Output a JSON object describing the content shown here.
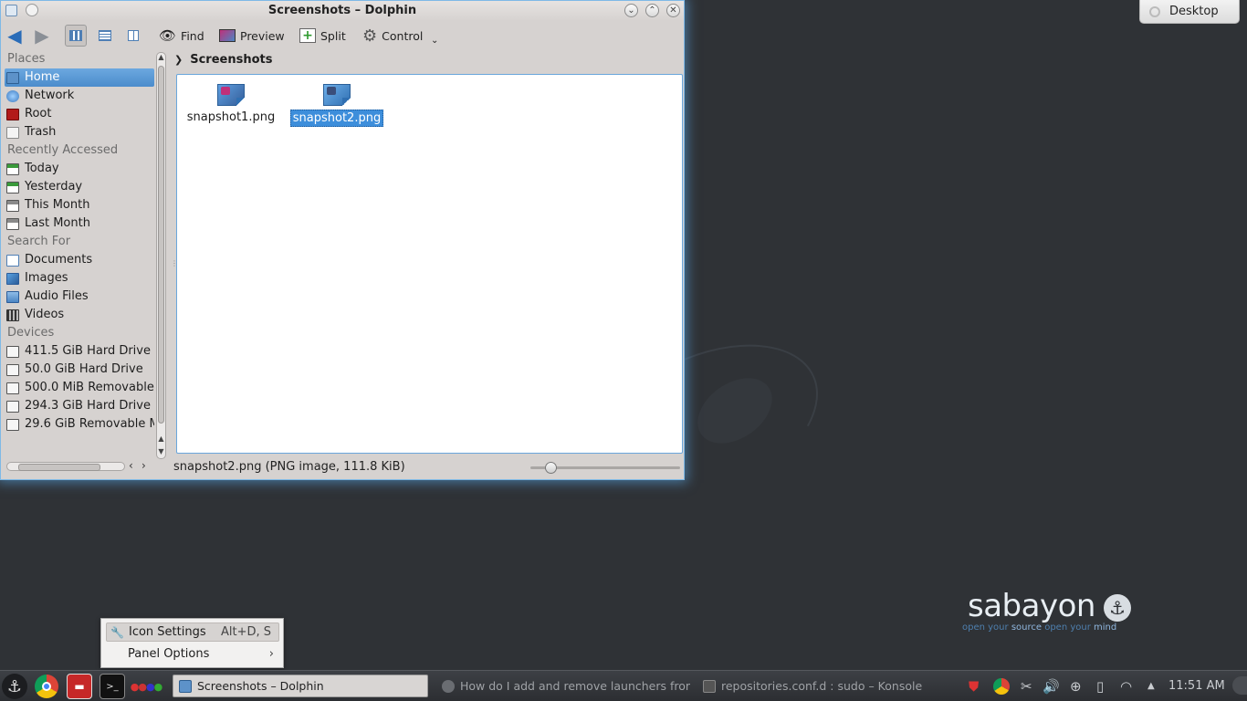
{
  "window": {
    "title": "Screenshots – Dolphin",
    "controls": {
      "minimize": "⌄",
      "maximize": "⌃",
      "close": "✕"
    }
  },
  "toolbar": {
    "back_icon": "go-previous-icon",
    "forward_icon": "go-next-icon",
    "find_label": "Find",
    "preview_label": "Preview",
    "split_label": "Split",
    "control_label": "Control",
    "more_icon": "chevron-down-icon"
  },
  "places": {
    "sections": [
      {
        "label": "Places",
        "items": [
          {
            "label": "Home",
            "icon": "home-folder-icon",
            "selected": true
          },
          {
            "label": "Network",
            "icon": "network-icon"
          },
          {
            "label": "Root",
            "icon": "root-folder-icon"
          },
          {
            "label": "Trash",
            "icon": "trash-icon"
          }
        ]
      },
      {
        "label": "Recently Accessed",
        "items": [
          {
            "label": "Today",
            "icon": "calendar-today-icon"
          },
          {
            "label": "Yesterday",
            "icon": "calendar-yesterday-icon"
          },
          {
            "label": "This Month",
            "icon": "calendar-month-icon"
          },
          {
            "label": "Last Month",
            "icon": "calendar-last-month-icon"
          }
        ]
      },
      {
        "label": "Search For",
        "items": [
          {
            "label": "Documents",
            "icon": "documents-icon"
          },
          {
            "label": "Images",
            "icon": "images-icon"
          },
          {
            "label": "Audio Files",
            "icon": "audio-icon"
          },
          {
            "label": "Videos",
            "icon": "videos-icon"
          }
        ]
      },
      {
        "label": "Devices",
        "items": [
          {
            "label": "411.5 GiB Hard Drive",
            "icon": "hard-drive-icon"
          },
          {
            "label": "50.0 GiB Hard Drive",
            "icon": "hard-drive-icon"
          },
          {
            "label": "500.0 MiB Removable",
            "icon": "removable-drive-icon"
          },
          {
            "label": "294.3 GiB Hard Drive",
            "icon": "hard-drive-icon"
          },
          {
            "label": "29.6 GiB Removable M",
            "icon": "removable-drive-icon"
          }
        ]
      }
    ]
  },
  "breadcrumb": {
    "current": "Screenshots"
  },
  "files": [
    {
      "name": "snapshot1.png",
      "selected": false
    },
    {
      "name": "snapshot2.png",
      "selected": true
    }
  ],
  "statusbar": {
    "text": "snapshot2.png (PNG image, 111.8 KiB)"
  },
  "desktop": {
    "button_label": "Desktop"
  },
  "context_menu": {
    "items": [
      {
        "label": "Icon Settings",
        "shortcut": "Alt+D, S",
        "icon": "wrench-icon"
      },
      {
        "label": "Panel Options",
        "submenu_icon": "chevron-right-icon"
      }
    ]
  },
  "branding": {
    "logo": "sabayon",
    "tagline_parts": [
      "open your ",
      "source",
      " open your ",
      "mind"
    ]
  },
  "taskbar": {
    "tasks": [
      {
        "label": "Screenshots – Dolphin",
        "active": true
      },
      {
        "label": "How do I add and remove launchers from th",
        "active": false
      },
      {
        "label": "repositories.conf.d : sudo – Konsole",
        "active": false
      }
    ],
    "clock": "11:51 AM"
  },
  "colors": {
    "accent": "#4b8ccc",
    "selection": "#3d8edb",
    "panel": "#2c2e32",
    "window_glow": "#5aaaeb"
  }
}
